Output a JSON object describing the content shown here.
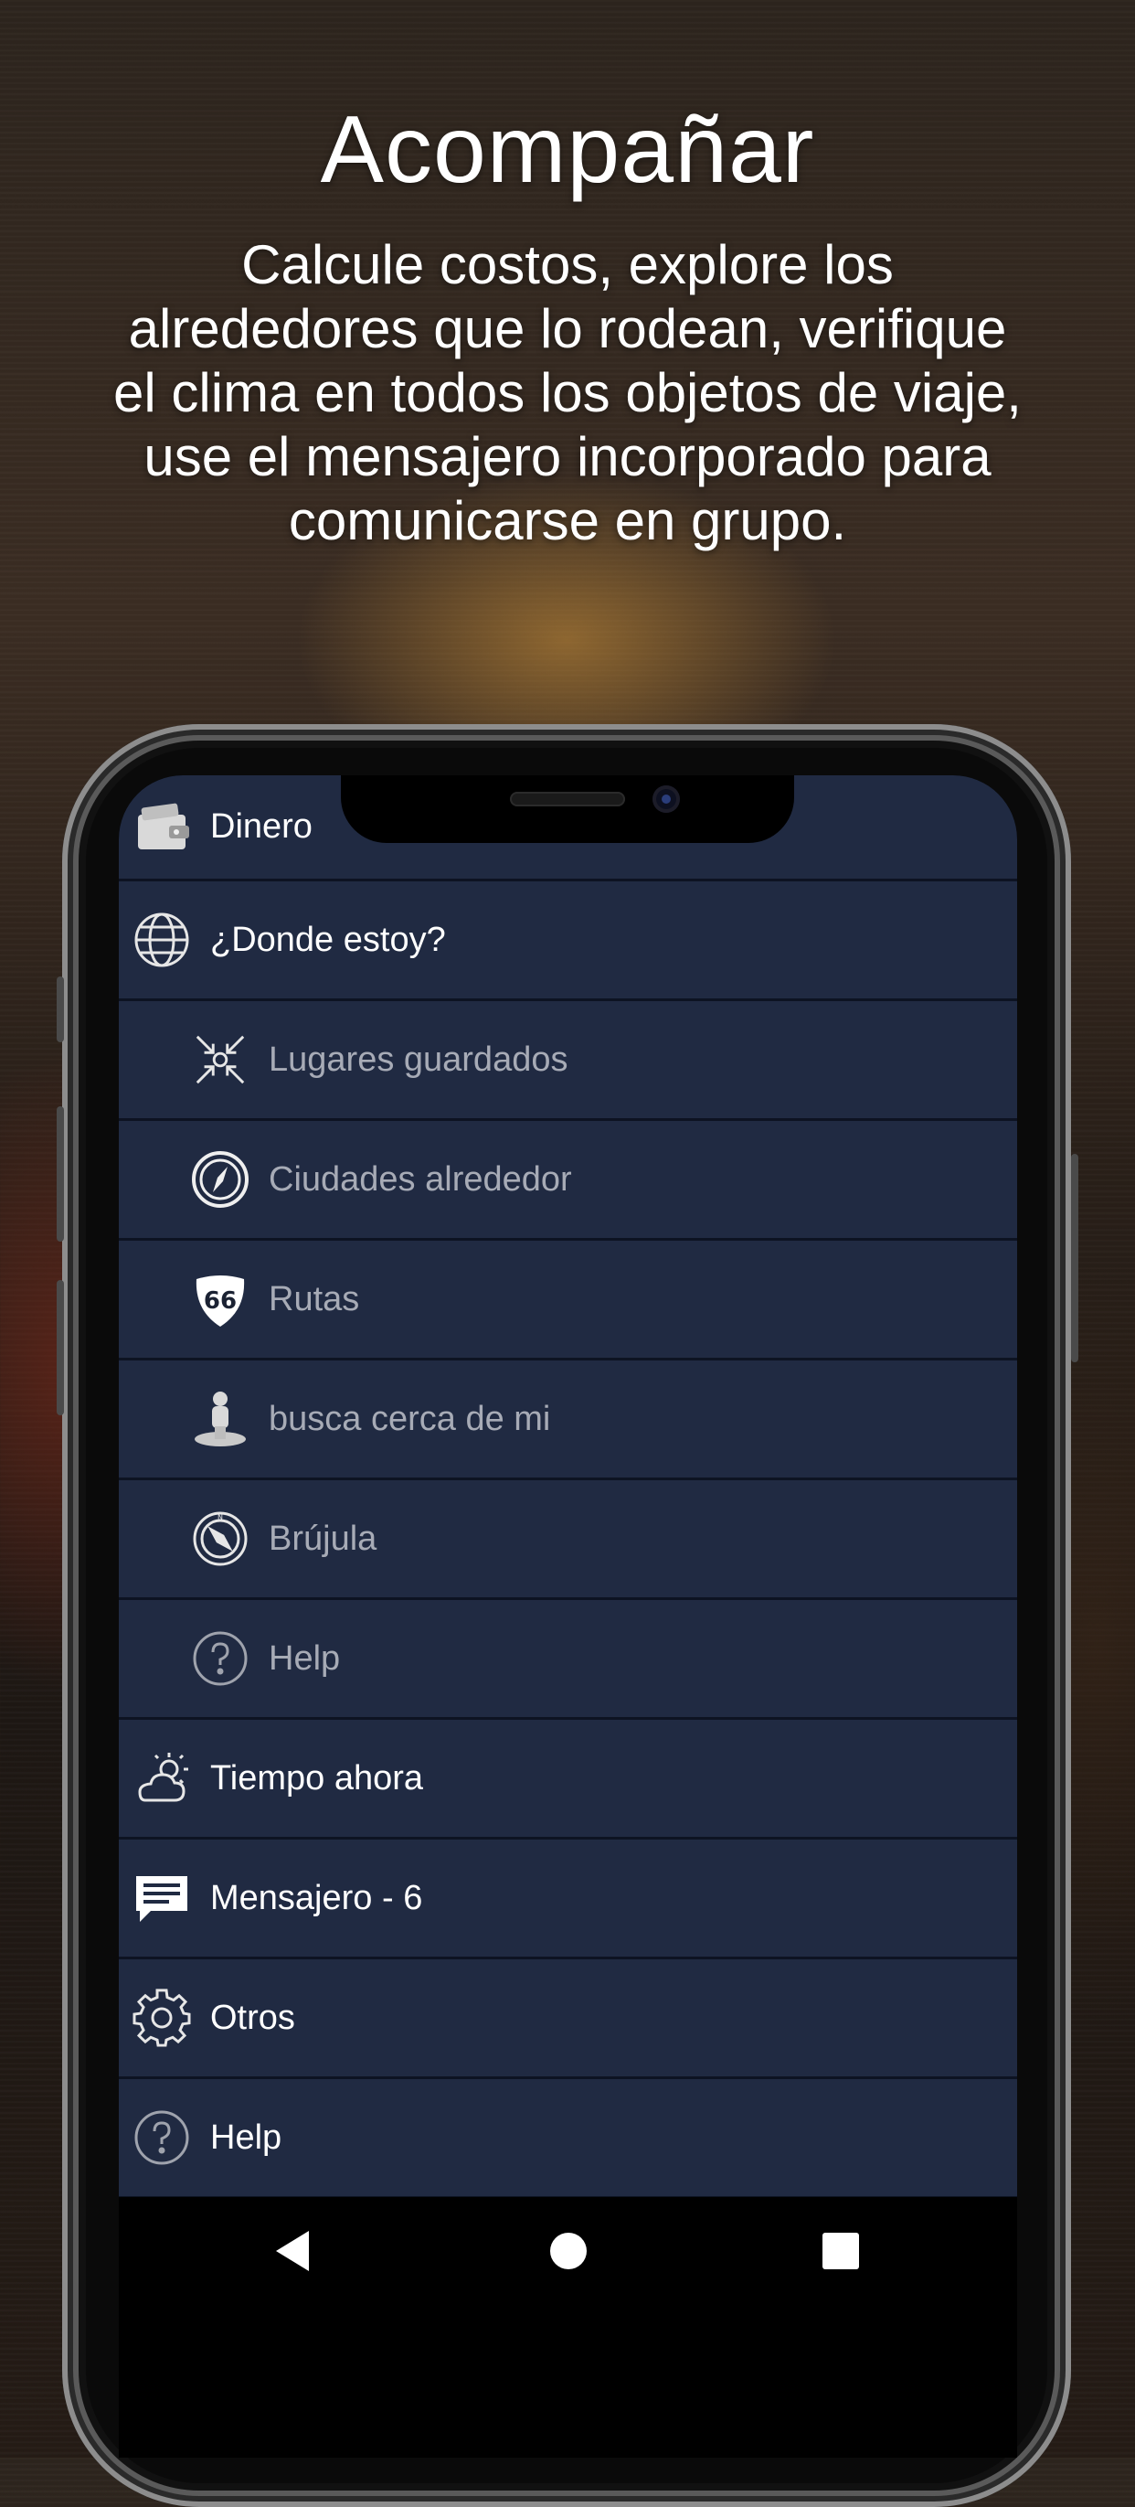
{
  "hero": {
    "title": "Acompañar",
    "subtitle": "Calcule costos, explore los alrededores que lo rodean, verifique el clima en todos los objetos de viaje, use el mensajero incorporado para comunicarse en grupo."
  },
  "menu": {
    "items": [
      {
        "label": "Dinero",
        "icon": "wallet-icon",
        "level": "top"
      },
      {
        "label": "¿Donde estoy?",
        "icon": "globe-icon",
        "level": "top"
      },
      {
        "label": "Lugares guardados",
        "icon": "arrows-converge-icon",
        "level": "sub"
      },
      {
        "label": "Ciudades alrededor",
        "icon": "compass-circle-icon",
        "level": "sub"
      },
      {
        "label": "Rutas",
        "icon": "route-66-shield-icon",
        "level": "sub"
      },
      {
        "label": "busca cerca de mi",
        "icon": "person-pin-icon",
        "level": "sub"
      },
      {
        "label": "Brújula",
        "icon": "compass-icon",
        "level": "sub"
      },
      {
        "label": "Help",
        "icon": "help-circle-icon",
        "level": "sub"
      },
      {
        "label": "Tiempo ahora",
        "icon": "weather-cloud-sun-icon",
        "level": "top"
      },
      {
        "label": "Mensajero - 6",
        "icon": "message-icon",
        "level": "top"
      },
      {
        "label": "Otros",
        "icon": "gear-icon",
        "level": "top"
      },
      {
        "label": "Help",
        "icon": "help-circle-icon",
        "level": "top"
      }
    ]
  },
  "colors": {
    "menu_bg": "#202a42",
    "divider": "#0d1322",
    "top_text": "#ffffff",
    "sub_text": "#a7abb6"
  }
}
